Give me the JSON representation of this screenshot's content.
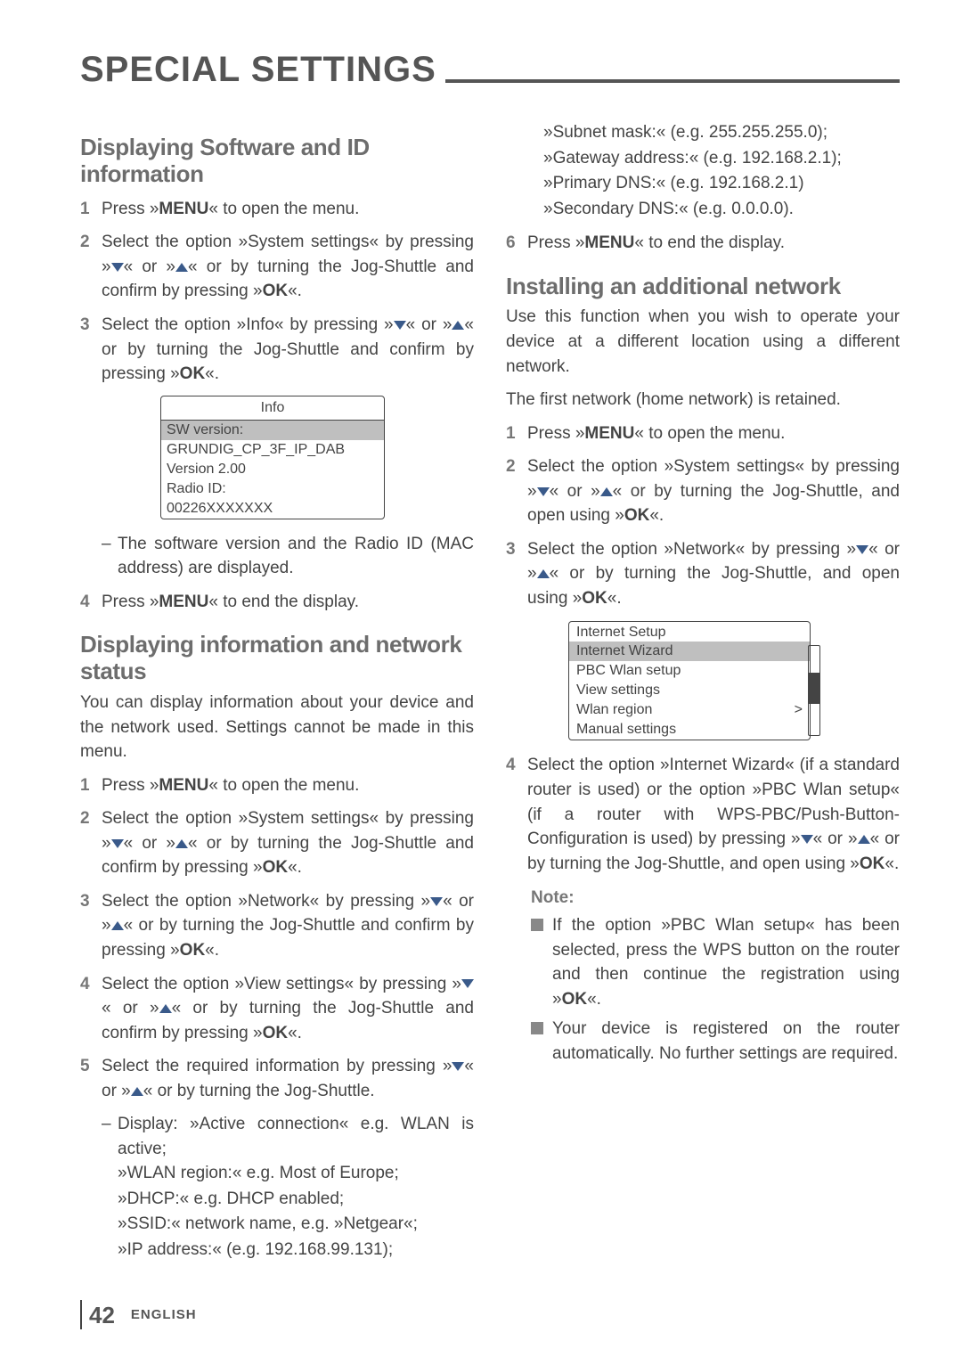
{
  "page": {
    "title": "SPECIAL SETTINGS",
    "number": "42",
    "lang": "ENGLISH"
  },
  "left": {
    "sec1_title": "Displaying Software and ID information",
    "s1": "Press »MENU« to open the menu.",
    "s2": "Select the option »System settings« by pressing »▾« or »▴« or by turning the Jog-Shuttle and confirm by pressing »OK«.",
    "s3": "Select the option »Info« by pressing »▾« or »▴« or by turning the Jog-Shuttle and confirm by pressing »OK«.",
    "info_box": {
      "title": "Info",
      "row_sel": "SW version:",
      "row2": "GRUNDIG_CP_3F_IP_DAB",
      "row3": "Version 2.00",
      "row4": "Radio ID:",
      "row5": "00226XXXXXXX"
    },
    "s3_note": "The software version and the Radio ID (MAC address) are displayed.",
    "s4": "Press »MENU« to end the display.",
    "sec2_title": "Displaying information and network status",
    "sec2_intro": "You can display information about your device and the network used. Settings cannot be made in this menu.",
    "n1": "Press »MENU« to open the menu.",
    "n2": "Select the option »System settings« by pressing »▾« or »▴« or by turning the Jog-Shuttle and confirm by pressing »OK«.",
    "n3": "Select the option »Network« by pressing »▾« or »▴« or by turning the Jog-Shuttle and confirm by pressing »OK«.",
    "n4": "Select the option »View settings« by pressing »▾« or »▴« or by turning the Jog-Shuttle and confirm by pressing »OK«.",
    "n5": "Select the required information by pressing »▾« or »▴« or by turning the Jog-Shuttle.",
    "n5_dash": "Display: »Active connection« e.g. WLAN is active;",
    "n5_l1": "»WLAN region:« e.g. Most of Europe;",
    "n5_l2": "»DHCP:« e.g. DHCP enabled;",
    "n5_l3": "»SSID:« network name, e.g. »Netgear«;",
    "n5_l4": "»IP address:« (e.g. 192.168.99.131);"
  },
  "right": {
    "cont_l1": "»Subnet mask:« (e.g. 255.255.255.0);",
    "cont_l2": "»Gateway address:« (e.g. 192.168.2.1);",
    "cont_l3": "»Primary DNS:« (e.g. 192.168.2.1)",
    "cont_l4": "»Secondary DNS:« (e.g. 0.0.0.0).",
    "s6": "Press »MENU« to end the display.",
    "sec3_title": "Installing an additional network",
    "sec3_intro": "Use this function when you wish to operate your device at a different location using a different network.",
    "sec3_note": "The first network (home network) is retained.",
    "a1": "Press »MENU« to open the menu.",
    "a2": "Select the option »System settings« by pressing »▾« or »▴« or by turning the Jog-Shuttle, and open using »OK«.",
    "a3": "Select the option »Network« by pressing »▾« or »▴« or by turning the Jog-Shuttle, and open using »OK«.",
    "menu_box": {
      "title": "Internet Setup",
      "row_sel": "Internet Wizard",
      "row2": "PBC Wlan setup",
      "row3": "View settings",
      "row4": "Wlan region",
      "row4_arrow": ">",
      "row5": "Manual settings"
    },
    "a4": "Select the option »Internet Wizard« (if a standard router is used) or the option »PBC Wlan setup« (if a router with WPS-PBC/Push-Button-Configuration is used) by pressing »▾« or »▴« or by turning the Jog-Shuttle, and open using »OK«.",
    "note_label": "Note:",
    "note_b1": "If the option »PBC Wlan setup« has been selected, press the WPS button on the router and then continue the registration using »OK«.",
    "note_b2": "Your device is registered on the router automatically. No further settings are required."
  }
}
